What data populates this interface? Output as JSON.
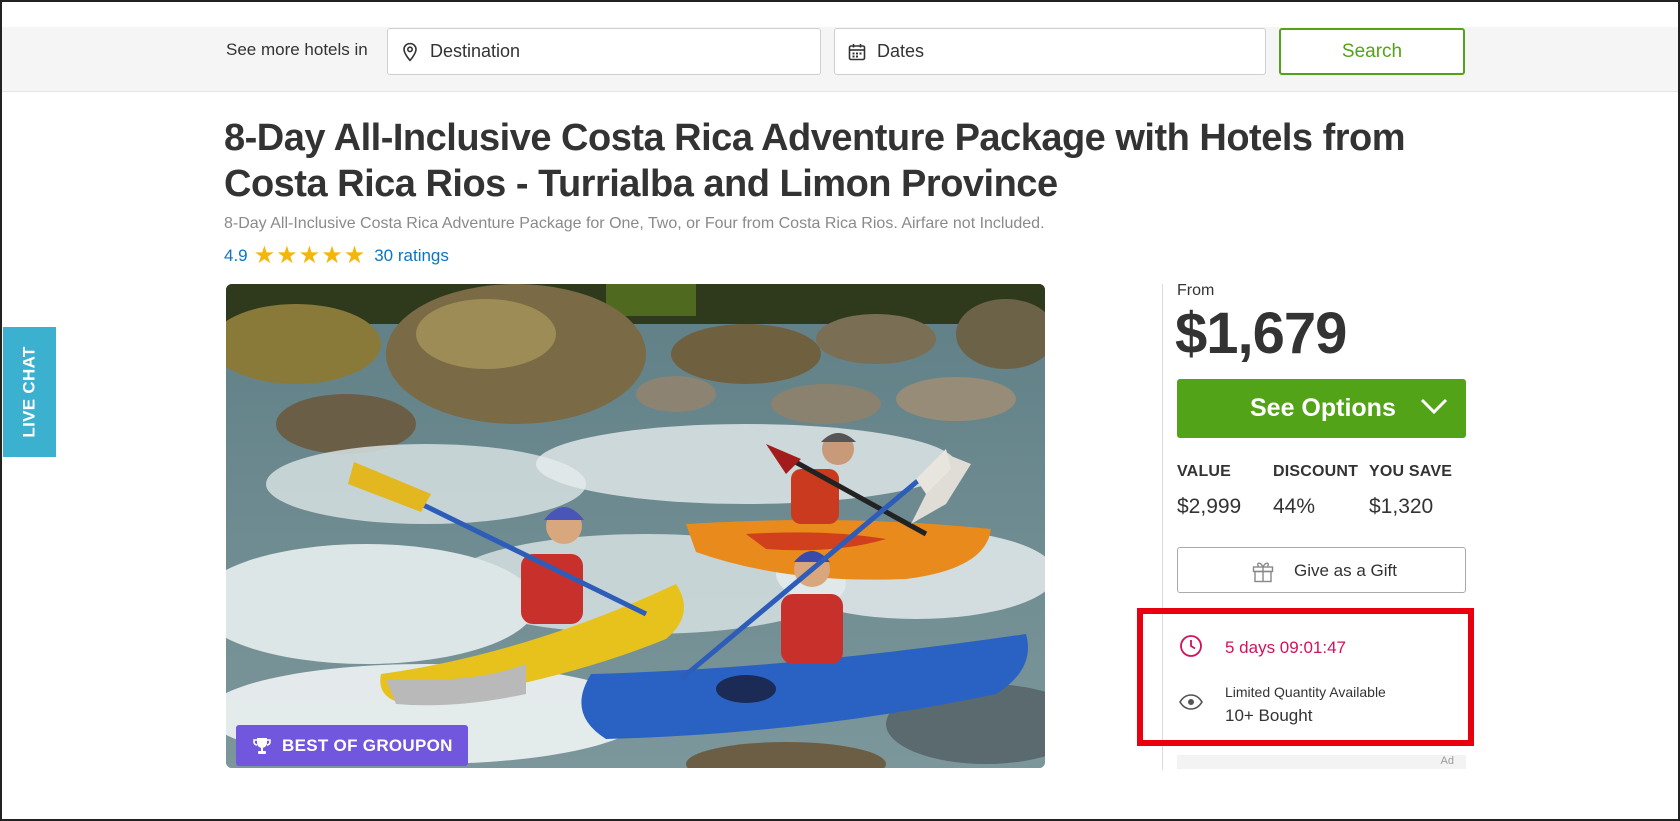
{
  "search_bar": {
    "label": "See more hotels in",
    "destination_placeholder": "Destination",
    "dates_placeholder": "Dates",
    "search_button": "Search"
  },
  "deal": {
    "title": "8-Day All-Inclusive Costa Rica Adventure Package with Hotels from Costa Rica Rios - Turrialba and Limon Province",
    "subtitle": "8-Day All-Inclusive Costa Rica Adventure Package for One, Two, or Four from Costa Rica Rios. Airfare not Included.",
    "rating_score": "4.9",
    "rating_stars": 5,
    "ratings_link": "30 ratings",
    "badge": "BEST OF GROUPON",
    "image_icons": [
      "trophy-icon"
    ]
  },
  "live_chat": {
    "label": "LIVE CHAT"
  },
  "purchase_panel": {
    "from_label": "From",
    "price": "$1,679",
    "see_options": "See Options",
    "stats": {
      "value_label": "VALUE",
      "value": "$2,999",
      "discount_label": "DISCOUNT",
      "discount": "44%",
      "save_label": "YOU SAVE",
      "save": "$1,320"
    },
    "gift_button": "Give as a Gift",
    "timer": "5 days 09:01:47",
    "limited": "Limited Quantity Available",
    "bought": "10+ Bought",
    "ad_label": "Ad"
  },
  "colors": {
    "brand_green": "#53a318",
    "link_blue": "#0b74c4",
    "star_gold": "#f5b60c",
    "badge_purple": "#7156de",
    "timer_red": "#d3115b",
    "highlight_red": "#e8000f",
    "chat_teal": "#3cb0cf"
  }
}
